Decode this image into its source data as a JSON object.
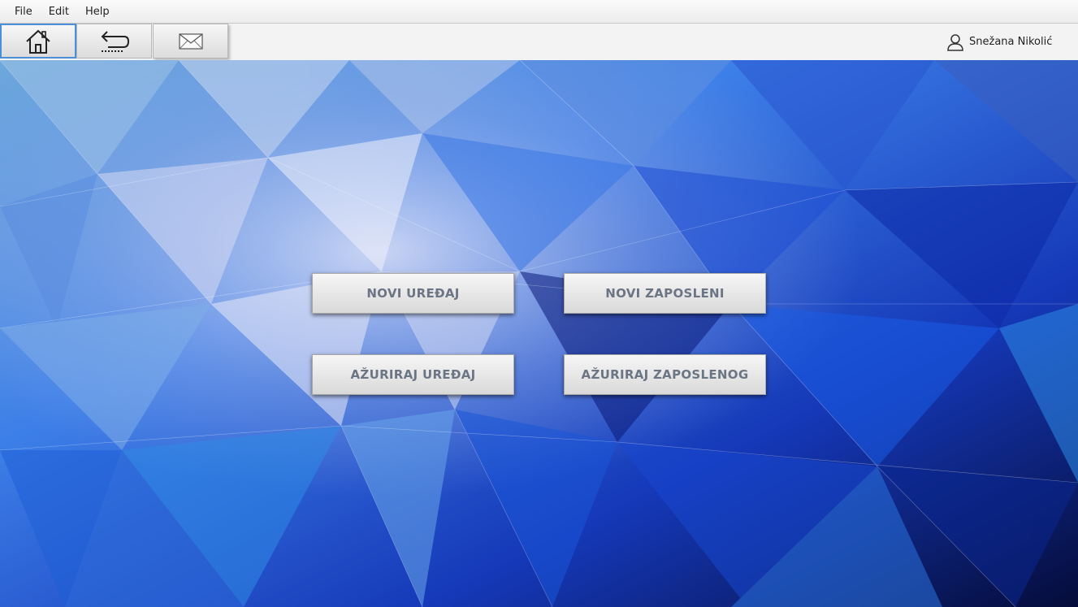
{
  "menu": {
    "file": "File",
    "edit": "Edit",
    "help": "Help"
  },
  "toolbar": {
    "home_icon": "home-icon",
    "back_icon": "back-arrow-icon",
    "mail_icon": "mail-icon"
  },
  "user": {
    "icon": "user-icon",
    "name": "Snežana Nikolić"
  },
  "actions": {
    "new_device": "NOVI UREĐAJ",
    "new_employee": "NOVI ZAPOSLENI",
    "update_device": "AŽURIRAJ UREĐAJ",
    "update_employee": "AŽURIRAJ ZAPOSLENOG"
  },
  "colors": {
    "background_dark": "#0b1a6b",
    "background_blue": "#1f5fe0",
    "background_light": "#cfd6f0",
    "button_text": "#6b7584",
    "focus_border": "#4a8fd8"
  }
}
